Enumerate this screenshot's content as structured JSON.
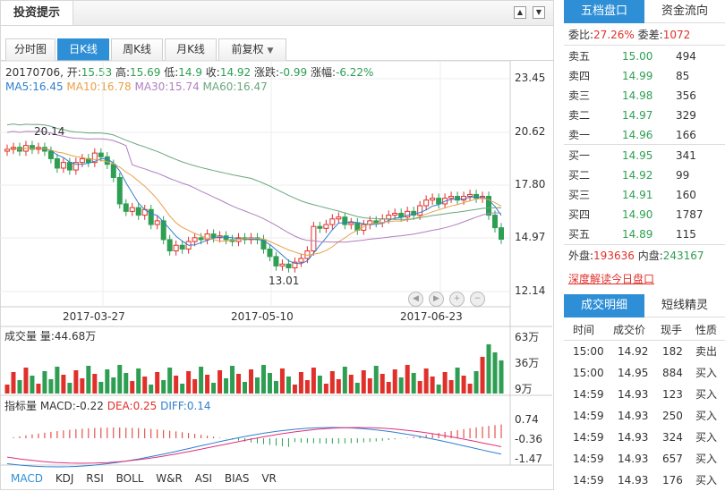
{
  "header": {
    "title": "投资提示",
    "up_arrow": "▲",
    "down_arrow": "▼"
  },
  "tabs": [
    {
      "label": "分时图"
    },
    {
      "label": "日K线"
    },
    {
      "label": "周K线"
    },
    {
      "label": "月K线"
    },
    {
      "label": "前复权"
    }
  ],
  "ohlc": {
    "date": "20170706",
    "open_label": "开:",
    "open": "15.53",
    "high_label": "高:",
    "high": "15.69",
    "low_label": "低:",
    "low": "14.9",
    "close_label": "收:",
    "close": "14.92",
    "change_label": "涨跌:",
    "change": "-0.99",
    "pct_label": "涨幅:",
    "pct": "-6.22%"
  },
  "ma": {
    "ma5": "MA5:16.45",
    "ma10": "MA10:16.78",
    "ma30": "MA30:15.74",
    "ma60": "MA60:16.47"
  },
  "colors": {
    "ma5": "#2e7fd0",
    "ma10": "#e8a04a",
    "ma30": "#b07fc0",
    "ma60": "#6aa67e",
    "up": "#e0302b",
    "down": "#2e9e53",
    "accent": "#2e8fd6"
  },
  "price_axis": [
    "23.45",
    "20.62",
    "17.80",
    "14.97",
    "12.14"
  ],
  "date_axis": [
    "2017-03-27",
    "2017-05-10",
    "2017-06-23"
  ],
  "annotations": {
    "high": "20.14",
    "low": "13.01"
  },
  "volume": {
    "title": "成交量 量:44.68万",
    "axis": [
      "63万",
      "36万",
      "9万"
    ]
  },
  "macd": {
    "title_prefix": "指标量 MACD:-0.22",
    "dea": "DEA:0.25",
    "diff": "DIFF:0.14",
    "axis": [
      "0.74",
      "-0.36",
      "-1.47"
    ]
  },
  "indicators": [
    "MACD",
    "KDJ",
    "RSI",
    "BOLL",
    "W&R",
    "ASI",
    "BIAS",
    "VR"
  ],
  "right_tabs": [
    "五档盘口",
    "资金流向"
  ],
  "weibi": {
    "label1": "委比:",
    "val1": "27.26%",
    "label2": "委差:",
    "val2": "1072"
  },
  "sell": [
    {
      "name": "卖五",
      "price": "15.00",
      "vol": "494"
    },
    {
      "name": "卖四",
      "price": "14.99",
      "vol": "85"
    },
    {
      "name": "卖三",
      "price": "14.98",
      "vol": "356"
    },
    {
      "name": "卖二",
      "price": "14.97",
      "vol": "329"
    },
    {
      "name": "卖一",
      "price": "14.96",
      "vol": "166"
    }
  ],
  "buy": [
    {
      "name": "买一",
      "price": "14.95",
      "vol": "341"
    },
    {
      "name": "买二",
      "price": "14.92",
      "vol": "99"
    },
    {
      "name": "买三",
      "price": "14.91",
      "vol": "160"
    },
    {
      "name": "买四",
      "price": "14.90",
      "vol": "1787"
    },
    {
      "name": "买五",
      "price": "14.89",
      "vol": "115"
    }
  ],
  "pan": {
    "outer_label": "外盘:",
    "outer": "193636",
    "inner_label": "内盘:",
    "inner": "243167"
  },
  "deep_link": "深度解读今日盘口",
  "trade_tabs": [
    "成交明细",
    "短线精灵"
  ],
  "trade_headers": [
    "时间",
    "成交价",
    "现手",
    "性质"
  ],
  "trades": [
    {
      "time": "15:00",
      "price": "14.92",
      "vol": "182",
      "type": "卖出"
    },
    {
      "time": "15:00",
      "price": "14.95",
      "vol": "884",
      "type": "买入"
    },
    {
      "time": "14:59",
      "price": "14.93",
      "vol": "123",
      "type": "买入"
    },
    {
      "time": "14:59",
      "price": "14.93",
      "vol": "250",
      "type": "买入"
    },
    {
      "time": "14:59",
      "price": "14.93",
      "vol": "324",
      "type": "买入"
    },
    {
      "time": "14:59",
      "price": "14.93",
      "vol": "657",
      "type": "买入"
    },
    {
      "time": "14:59",
      "price": "14.93",
      "vol": "176",
      "type": "买入"
    }
  ],
  "chart_data": {
    "type": "candlestick",
    "x_labels": [
      "2017-03-27",
      "2017-05-10",
      "2017-06-23"
    ],
    "price_ylim": [
      12.14,
      23.45
    ],
    "annotated_high": 20.14,
    "annotated_low": 13.01,
    "last": {
      "date": "20170706",
      "open": 15.53,
      "high": 15.69,
      "low": 14.9,
      "close": 14.92
    },
    "series": [
      {
        "name": "MA5",
        "values": [
          16.45
        ]
      },
      {
        "name": "MA10",
        "values": [
          16.78
        ]
      },
      {
        "name": "MA30",
        "values": [
          15.74
        ]
      },
      {
        "name": "MA60",
        "values": [
          16.47
        ]
      }
    ],
    "volume_ylim_wan": [
      9,
      63
    ],
    "macd_ylim": [
      -1.47,
      0.74
    ]
  }
}
